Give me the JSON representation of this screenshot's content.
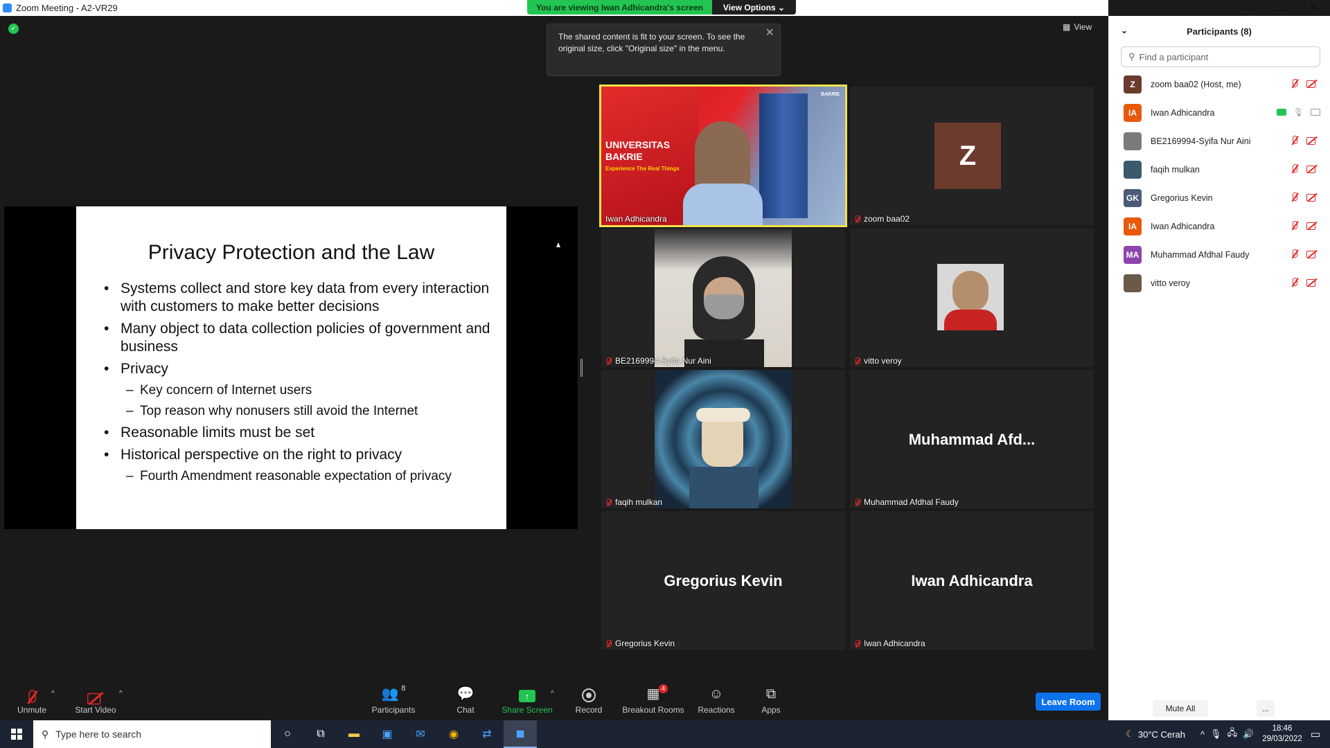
{
  "window": {
    "title": "Zoom Meeting - A2-VR29",
    "minimize": "—",
    "restore": "❐",
    "close": "✕"
  },
  "share_banner": {
    "text": "You are viewing Iwan Adhicandra's screen",
    "view_options": "View Options ⌄"
  },
  "view_button": "View",
  "tooltip": {
    "text": "The shared content is fit to your screen. To see the original size, click \"Original size\" in the menu."
  },
  "slide": {
    "title": "Privacy Protection and the Law",
    "bullets": [
      "Systems collect and store key data from every interaction with customers to make better decisions",
      "Many object to data collection policies of government and business",
      "Privacy",
      "Key concern of Internet users",
      "Top reason why nonusers still avoid the Internet",
      "Reasonable limits must be set",
      "Historical perspective on the right to privacy",
      "Fourth Amendment reasonable expectation of privacy"
    ]
  },
  "video_tiles": [
    {
      "name": "Iwan Adhicandra",
      "banner_line1": "UNIVERSITAS",
      "banner_line2": "BAKRIE",
      "banner_tagline": "Experience The Real Things",
      "logo_text": "BAKRIE"
    },
    {
      "name": "zoom baa02",
      "avatar_letter": "Z"
    },
    {
      "name": "BE2169994-Syifa Nur Aini"
    },
    {
      "name": "vitto veroy"
    },
    {
      "name": "faqih mulkan"
    },
    {
      "name": "Muhammad Afdhal Faudy",
      "display": "Muhammad  Afd..."
    },
    {
      "name": "Gregorius Kevin",
      "display": "Gregorius Kevin"
    },
    {
      "name": "Iwan Adhicandra",
      "display": "Iwan Adhicandra"
    }
  ],
  "toolbar": {
    "unmute": "Unmute",
    "start_video": "Start Video",
    "participants": "Participants",
    "participants_count": "8",
    "chat": "Chat",
    "share_screen": "Share Screen",
    "record": "Record",
    "breakout_rooms": "Breakout Rooms",
    "breakout_badge": "4",
    "reactions": "Reactions",
    "apps": "Apps",
    "leave": "Leave Room"
  },
  "participants_panel": {
    "header": "Participants (8)",
    "search_placeholder": "Find a participant",
    "items": [
      {
        "initials": "Z",
        "name": "zoom baa02 (Host, me)",
        "color": "#6b3b2e"
      },
      {
        "initials": "IA",
        "name": "Iwan Adhicandra",
        "color": "#e8590c"
      },
      {
        "initials": "",
        "name": "BE2169994-Syifa Nur Aini",
        "color": "#7a7a7a"
      },
      {
        "initials": "",
        "name": "faqih mulkan",
        "color": "#3b5a6b"
      },
      {
        "initials": "GK",
        "name": "Gregorius Kevin",
        "color": "#495b78"
      },
      {
        "initials": "IA",
        "name": "Iwan Adhicandra",
        "color": "#e8590c"
      },
      {
        "initials": "MA",
        "name": "Muhammad Afdhal Faudy",
        "color": "#8e44ad"
      },
      {
        "initials": "",
        "name": "vitto veroy",
        "color": "#6b5a4a"
      }
    ],
    "mute_all": "Mute All",
    "more": "..."
  },
  "taskbar": {
    "search_placeholder": "Type here to search",
    "weather": "30°C  Cerah",
    "time": "18:46",
    "date": "29/03/2022"
  }
}
